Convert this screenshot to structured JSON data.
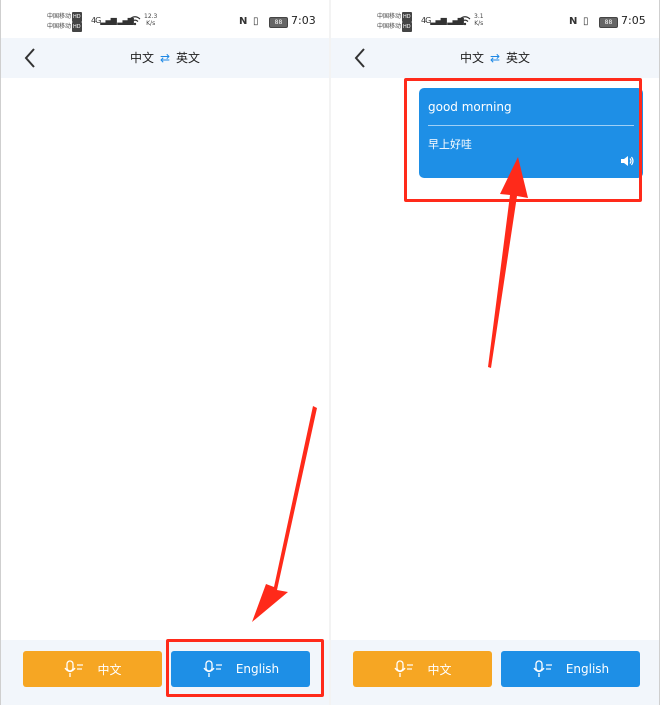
{
  "status_left": {
    "carrier1": "中国移动",
    "carrier2": "中国移动",
    "hd": "HD",
    "net": "4G",
    "speed_value": "12.3",
    "speed_unit": "K/s",
    "nfc": "N",
    "battery": "88",
    "time": "7:03"
  },
  "status_right": {
    "carrier1": "中国移动",
    "carrier2": "中国移动",
    "hd": "HD",
    "net": "4G",
    "speed_value": "3.1",
    "speed_unit": "K/s",
    "nfc": "N",
    "battery": "88",
    "time": "7:05"
  },
  "nav": {
    "source_lang": "中文",
    "swap_symbol": "⇄",
    "target_lang": "英文"
  },
  "bubble": {
    "source_text": "good morning",
    "translated_text": "早上好哇"
  },
  "buttons": {
    "chinese_label": "中文",
    "english_label": "English"
  },
  "colors": {
    "accent_blue": "#1e8fe6",
    "accent_orange": "#f6a623",
    "highlight_red": "#ff2a1a"
  },
  "icons": [
    "back-chevron-icon",
    "swap-icon",
    "microphone-icon",
    "speaker-icon",
    "wifi-icon",
    "nfc-icon",
    "battery-icon"
  ]
}
